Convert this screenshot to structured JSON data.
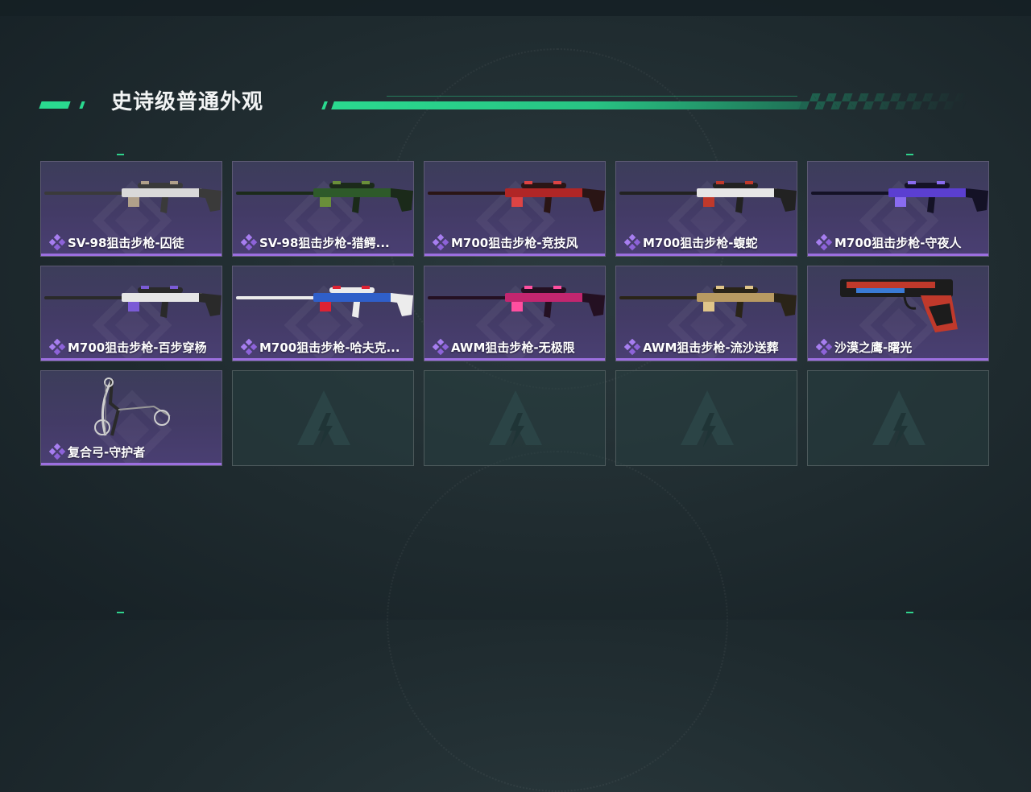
{
  "section": {
    "title": "史诗级普通外观"
  },
  "colors": {
    "accent_green": "#2ad98f",
    "epic_purple": "#9c6fe0",
    "card_bg": "#433b66"
  },
  "items": [
    {
      "name": "SV-98狙击步枪-囚徒",
      "icon": "sniper-rifle-icon",
      "skin": [
        "#d9d9d9",
        "#3a3a3a",
        "#b0a08a"
      ]
    },
    {
      "name": "SV-98狙击步枪-猎鳄...",
      "icon": "sniper-rifle-icon",
      "skin": [
        "#2e5a2a",
        "#1b2a1a",
        "#6a8f3a"
      ]
    },
    {
      "name": "M700狙击步枪-竞技风",
      "icon": "sniper-rifle-icon",
      "skin": [
        "#b02626",
        "#2a1515",
        "#d44"
      ]
    },
    {
      "name": "M700狙击步枪-蝮蛇",
      "icon": "sniper-rifle-icon",
      "skin": [
        "#e6e6e6",
        "#222",
        "#c0392b"
      ]
    },
    {
      "name": "M700狙击步枪-守夜人",
      "icon": "sniper-rifle-icon",
      "skin": [
        "#5b3fd1",
        "#141226",
        "#8a6cf0"
      ]
    },
    {
      "name": "M700狙击步枪-百步穿杨",
      "icon": "sniper-rifle-icon",
      "skin": [
        "#e6e6e6",
        "#2a2a2a",
        "#7b5bd6"
      ]
    },
    {
      "name": "M700狙击步枪-哈夫克...",
      "icon": "sniper-rifle-icon",
      "skin": [
        "#2f5fc9",
        "#ececec",
        "#d23"
      ]
    },
    {
      "name": "AWM狙击步枪-无极限",
      "icon": "sniper-rifle-icon",
      "skin": [
        "#c2266f",
        "#241022",
        "#ff4fa0"
      ]
    },
    {
      "name": "AWM狙击步枪-流沙送葬",
      "icon": "sniper-rifle-icon",
      "skin": [
        "#b89a62",
        "#2a2418",
        "#e0c58a"
      ]
    },
    {
      "name": "沙漠之鹰-曙光",
      "icon": "pistol-icon",
      "skin": [
        "#c0392b",
        "#1c1c1c",
        "#3a7bd5"
      ]
    },
    {
      "name": "复合弓-守护者",
      "icon": "compound-bow-icon",
      "skin": [
        "#cfcfcf",
        "#2a2a2a",
        "#999"
      ]
    }
  ],
  "empty_slots": 4
}
